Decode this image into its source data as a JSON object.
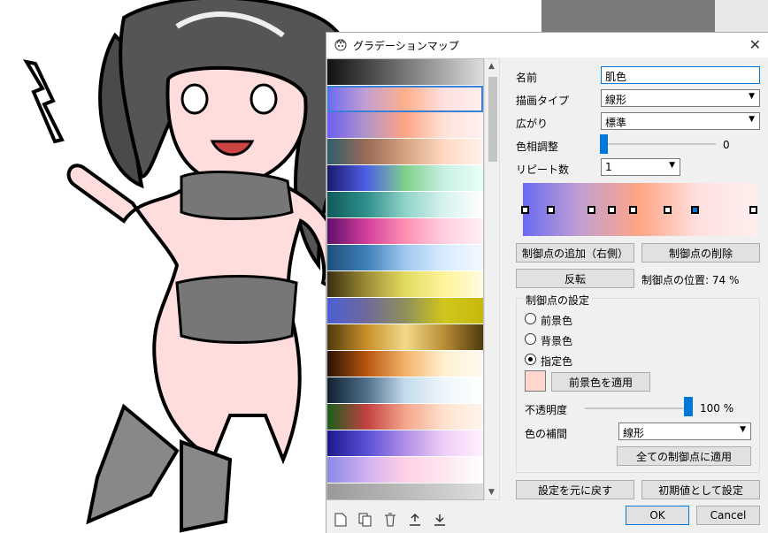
{
  "dialog": {
    "title": "グラデーションマップ",
    "close_glyph": "✕"
  },
  "gradients": [
    {
      "stops": [
        "#111111",
        "#777777",
        "#dddddd"
      ]
    },
    {
      "stops": [
        "#6b6bf2",
        "#c3a0d0",
        "#ffb08c",
        "#ffe0e0",
        "#ffefef"
      ],
      "selected": true
    },
    {
      "stops": [
        "#6a5ff3",
        "#b494c6",
        "#ffa585",
        "#ffe2d8",
        "#fff0f0"
      ]
    },
    {
      "stops": [
        "#2e5f6b",
        "#9a6b58",
        "#d7a37f",
        "#ffd9c2",
        "#fff2ee"
      ]
    },
    {
      "stops": [
        "#1a1a6b",
        "#4e5fe6",
        "#7fd08a",
        "#c8f0e2",
        "#e9fffa"
      ]
    },
    {
      "stops": [
        "#0f5b5b",
        "#2e8f8a",
        "#8fd3c8",
        "#d7f3ef",
        "#ffffff"
      ]
    },
    {
      "stops": [
        "#5f0f6b",
        "#d13f9a",
        "#ff8fb2",
        "#ffcfe0",
        "#fff0f6"
      ]
    },
    {
      "stops": [
        "#1f4f7a",
        "#3d7fb8",
        "#9fc8ef",
        "#d8ecff",
        "#f3f8ff"
      ]
    },
    {
      "stops": [
        "#3a2f12",
        "#9c8c35",
        "#e2dc62",
        "#fff39a",
        "#fffbe1"
      ]
    },
    {
      "stops": [
        "#4a5fd6",
        "#6f6a9a",
        "#8f8f5a",
        "#d0c61e",
        "#c7b80b"
      ]
    },
    {
      "stops": [
        "#4e3a0f",
        "#c78f2a",
        "#f4d98a",
        "#b98d34",
        "#4e3a0f"
      ]
    },
    {
      "stops": [
        "#2a1205",
        "#b8550f",
        "#f3b36c",
        "#fff0d0",
        "#fffaf0"
      ]
    },
    {
      "stops": [
        "#102030",
        "#4e6f8a",
        "#c4dcec",
        "#eef6fb",
        "#ffffff"
      ]
    },
    {
      "stops": [
        "#1a5f1a",
        "#c24040",
        "#f4a58a",
        "#ffe2ce",
        "#fff6ee"
      ]
    },
    {
      "stops": [
        "#1a1a8a",
        "#5a4fd6",
        "#b08fe6",
        "#f0cff7",
        "#fff0ff"
      ]
    },
    {
      "stops": [
        "#8a8ae6",
        "#d0b0f0",
        "#ffd0e6",
        "#ffe6f0",
        "#ffffff"
      ]
    },
    {
      "stops": [
        "#999999",
        "#bbbbbb",
        "#dddddd"
      ]
    }
  ],
  "scroll": {
    "up": "▲",
    "down": "▼"
  },
  "bottom_icons": [
    "new-icon",
    "duplicate-icon",
    "delete-icon",
    "import-icon",
    "export-icon"
  ],
  "props": {
    "name_label": "名前",
    "name_value": "肌色",
    "draw_type_label": "描画タイプ",
    "draw_type_value": "線形",
    "spread_label": "広がり",
    "spread_value": "標準",
    "hue_label": "色相調整",
    "hue_value": "0",
    "repeat_label": "リピート数",
    "repeat_value": "1"
  },
  "gradient_bar": {
    "stops": [
      "#6b6bf2",
      "#c3a0d0",
      "#ffa585",
      "#ffe0e0",
      "#ffefef"
    ]
  },
  "buttons": {
    "add_point": "制御点の追加（右側）",
    "delete_point": "制御点の削除",
    "reverse": "反転",
    "reset": "設定を元に戻す",
    "set_default": "初期値として設定",
    "ok": "OK",
    "cancel": "Cancel",
    "apply_fg": "前景色を適用",
    "apply_all": "全ての制御点に適用"
  },
  "point_position_label": "制御点の位置: 74 %",
  "point_settings": {
    "title": "制御点の設定",
    "radio_fg": "前景色",
    "radio_bg": "背景色",
    "radio_custom": "指定色",
    "selected": "指定色",
    "swatch_color": "#ffd6cc",
    "opacity_label": "不透明度",
    "opacity_value": "100 %",
    "interp_label": "色の補間",
    "interp_value": "線形"
  }
}
